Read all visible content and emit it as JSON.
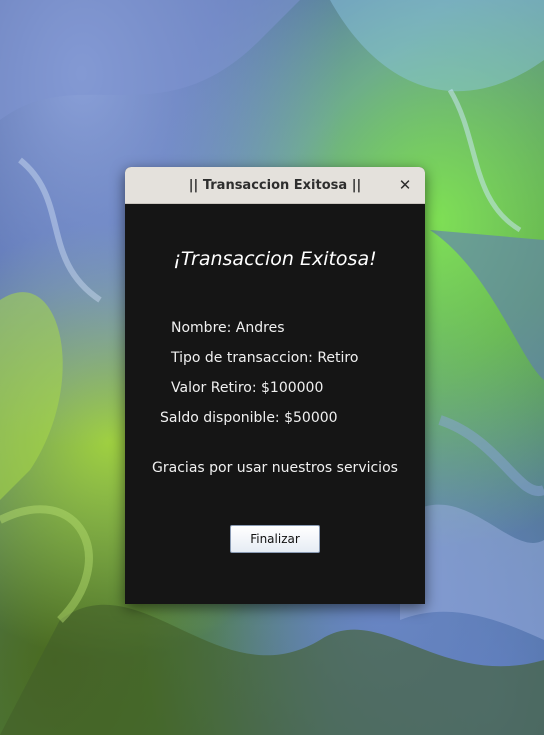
{
  "window": {
    "title": "|| Transaccion Exitosa ||",
    "close_glyph": "✕"
  },
  "message": {
    "headline": "¡Transaccion Exitosa!",
    "name_line": "Nombre: Andres",
    "type_line": "Tipo de transaccion: Retiro",
    "amount_line": "Valor Retiro: $100000",
    "balance_line": "Saldo disponible: $50000",
    "thanks": "Gracias por usar nuestros servicios"
  },
  "buttons": {
    "finish_label": "Finalizar"
  },
  "colors": {
    "window_bg": "#151515",
    "titlebar_bg": "#e4e1dc",
    "text": "#f0f0f0"
  }
}
